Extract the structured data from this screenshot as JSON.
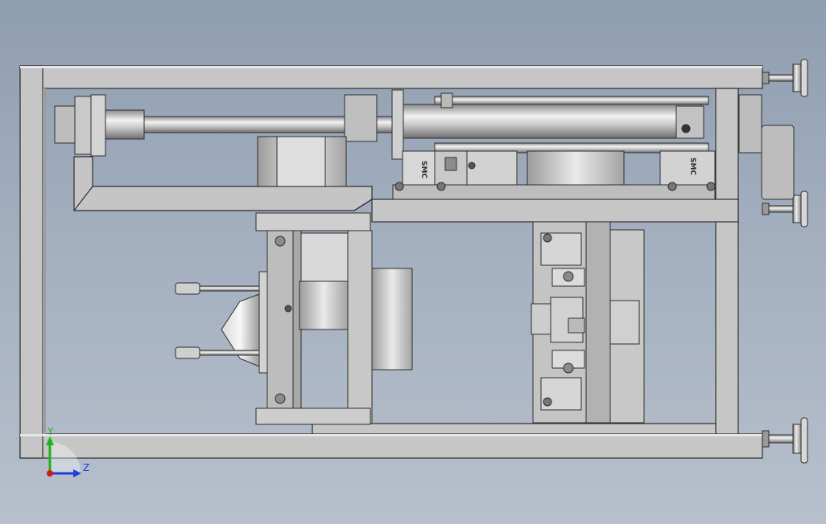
{
  "viewport": {
    "background_top": "#8f9db0",
    "background_bottom": "#b7c0cc"
  },
  "model": {
    "cylinder_brand_marks": [
      "SMC",
      "SMC"
    ]
  },
  "triad": {
    "y_label": "Y",
    "z_label": "Z",
    "y_color": "#1db31d",
    "z_color": "#1f3fd6",
    "x_color": "#d01a1a"
  }
}
